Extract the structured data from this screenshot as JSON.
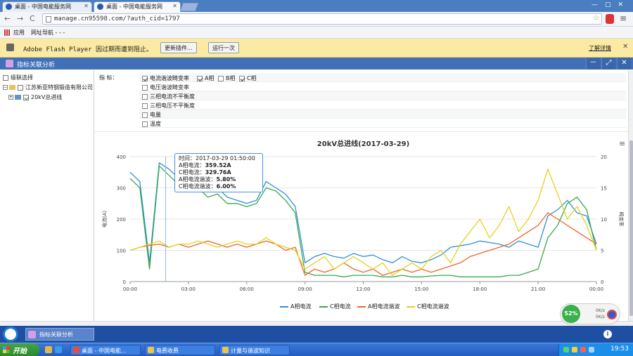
{
  "browser": {
    "tabs": [
      {
        "label": "桌面 - 中国电能服务网"
      },
      {
        "label": "桌面 - 中国电能服务网"
      }
    ],
    "url": "manage.cn95598.com/?auth_cid=1797",
    "bookmarks": {
      "apps": "应用",
      "nav": "网址导航 - - -"
    }
  },
  "flash_bar": {
    "message": "Adobe Flash Player 因过期而遭到阻止。",
    "update_btn": "更新插件...",
    "run_btn": "运行一次",
    "learn_more": "了解详情"
  },
  "app": {
    "title": "指标关联分析",
    "header_btns": {
      "min": "－",
      "max": "⤢",
      "close": "✕"
    }
  },
  "tree": {
    "header": "级联选择",
    "company": "江苏新亚特钢锻造有限公司",
    "line": "20kV总进线"
  },
  "filter": {
    "label": "指 标：",
    "rows": [
      [
        {
          "label": "电流谐波畸变率",
          "checked": true
        },
        {
          "label": "A相",
          "checked": true
        },
        {
          "label": "B相",
          "checked": false
        },
        {
          "label": "C相",
          "checked": true
        }
      ],
      [
        {
          "label": "电压谐波畸变率",
          "checked": false
        }
      ],
      [
        {
          "label": "三相电流不平衡度",
          "checked": false
        }
      ],
      [
        {
          "label": "三相电压不平衡度",
          "checked": false
        }
      ],
      [
        {
          "label": "电量",
          "checked": false
        }
      ],
      [
        {
          "label": "温度",
          "checked": false
        }
      ]
    ]
  },
  "tooltip": {
    "time_label": "时间：",
    "time": "2017-03-29 01:50:00",
    "a_cur_label": "A相电流：",
    "a_cur": "359.52A",
    "c_cur_label": "C相电流：",
    "c_cur": "329.76A",
    "a_h_label": "A相电流谐波：",
    "a_h": "5.80%",
    "c_h_label": "C相电流谐波：",
    "c_h": "6.00%"
  },
  "chart_data": {
    "type": "line",
    "title": "20kV总进线(2017-03-29)",
    "ylabel": "电流(A)",
    "y2label": "畸变率",
    "ylim": [
      0,
      400
    ],
    "y2lim": [
      0,
      20
    ],
    "yticks": [
      0,
      100,
      200,
      300,
      400
    ],
    "y2ticks": [
      0,
      5,
      10,
      15,
      20
    ],
    "xticks": [
      "00:00",
      "03:00",
      "06:00",
      "09:00",
      "12:00",
      "15:00",
      "18:00",
      "21:00",
      "00:00"
    ],
    "xlim_hours": [
      0,
      24
    ],
    "colors": {
      "a_cur": "#2f8fd8",
      "c_cur": "#3aa84a",
      "a_h": "#f0642a",
      "c_h": "#e6d21e"
    },
    "series": [
      {
        "name": "A相电流",
        "axis": "left",
        "x": [
          0,
          0.5,
          1,
          1.5,
          2,
          2.5,
          3,
          3.5,
          4,
          4.5,
          5,
          5.5,
          6,
          6.5,
          7,
          7.5,
          8,
          8.5,
          9,
          9.5,
          10,
          10.5,
          11,
          11.5,
          12,
          12.5,
          13,
          13.5,
          14,
          14.5,
          15,
          15.5,
          16,
          16.5,
          17,
          17.5,
          18,
          18.5,
          19,
          19.5,
          20,
          20.5,
          21,
          21.5,
          22,
          22.5,
          23,
          23.5,
          24
        ],
        "y": [
          350,
          320,
          60,
          380,
          360,
          330,
          340,
          320,
          290,
          300,
          270,
          260,
          250,
          260,
          320,
          300,
          280,
          240,
          60,
          80,
          90,
          80,
          75,
          90,
          80,
          85,
          70,
          60,
          80,
          65,
          60,
          70,
          85,
          110,
          115,
          120,
          130,
          125,
          120,
          110,
          130,
          120,
          110,
          210,
          230,
          260,
          220,
          210,
          120
        ]
      },
      {
        "name": "C相电流",
        "axis": "left",
        "x": [
          0,
          0.5,
          1,
          1.5,
          2,
          2.5,
          3,
          3.5,
          4,
          4.5,
          5,
          5.5,
          6,
          6.5,
          7,
          7.5,
          8,
          8.5,
          9,
          9.5,
          10,
          10.5,
          11,
          11.5,
          12,
          12.5,
          13,
          13.5,
          14,
          14.5,
          15,
          15.5,
          16,
          16.5,
          17,
          17.5,
          18,
          18.5,
          19,
          19.5,
          20,
          20.5,
          21,
          21.5,
          22,
          22.5,
          23,
          23.5,
          24
        ],
        "y": [
          330,
          300,
          40,
          370,
          340,
          310,
          320,
          300,
          270,
          280,
          250,
          250,
          240,
          250,
          300,
          290,
          260,
          220,
          30,
          20,
          20,
          20,
          15,
          20,
          20,
          20,
          15,
          15,
          20,
          15,
          15,
          18,
          20,
          20,
          15,
          15,
          15,
          15,
          15,
          20,
          20,
          30,
          40,
          140,
          180,
          250,
          270,
          230,
          100
        ]
      },
      {
        "name": "A相电流谐波",
        "axis": "right",
        "x": [
          0,
          0.5,
          1,
          1.5,
          2,
          2.5,
          3,
          3.5,
          4,
          4.5,
          5,
          5.5,
          6,
          6.5,
          7,
          7.5,
          8,
          8.5,
          9,
          9.5,
          10,
          10.5,
          11,
          11.5,
          12,
          12.5,
          13,
          13.5,
          14,
          14.5,
          15,
          15.5,
          16,
          16.5,
          17,
          17.5,
          18,
          18.5,
          19,
          19.5,
          20,
          20.5,
          21,
          21.5,
          22,
          22.5,
          23,
          23.5,
          24
        ],
        "y": [
          5,
          5.5,
          5.8,
          6,
          5.5,
          6,
          5.5,
          6,
          6.5,
          6,
          5.5,
          6,
          5.5,
          6,
          6.5,
          6,
          5,
          5.5,
          1,
          2,
          1.5,
          2,
          3,
          2,
          1.5,
          2,
          1,
          1.5,
          2,
          1.5,
          2,
          1.5,
          2,
          2.5,
          3,
          4,
          4.5,
          5,
          5.5,
          6,
          7,
          8,
          9,
          11,
          10,
          9,
          8,
          7,
          6
        ]
      },
      {
        "name": "C相电流谐波",
        "axis": "right",
        "x": [
          0,
          0.5,
          1,
          1.5,
          2,
          2.5,
          3,
          3.5,
          4,
          4.5,
          5,
          5.5,
          6,
          6.5,
          7,
          7.5,
          8,
          8.5,
          9,
          9.5,
          10,
          10.5,
          11,
          11.5,
          12,
          12.5,
          13,
          13.5,
          14,
          14.5,
          15,
          15.5,
          16,
          16.5,
          17,
          17.5,
          18,
          18.5,
          19,
          19.5,
          20,
          20.5,
          21,
          21.5,
          22,
          22.5,
          23,
          23.5,
          24
        ],
        "y": [
          5,
          5.5,
          6,
          6.5,
          5.5,
          6,
          6,
          6.5,
          6,
          5.5,
          6,
          6.5,
          6,
          6,
          7,
          6,
          5.5,
          5,
          2,
          3,
          4,
          2,
          3,
          4,
          3,
          2,
          3,
          1,
          2,
          3,
          2,
          4,
          5,
          3,
          6,
          8,
          10,
          7,
          9,
          12,
          8,
          10,
          13,
          18,
          14,
          10,
          12,
          9,
          5
        ]
      }
    ]
  },
  "widget": {
    "pct": "52%",
    "up": "0K/s",
    "down": "0K/s"
  },
  "dock": {
    "task": "指标关联分析",
    "info": "i"
  },
  "taskbar": {
    "start": "开始",
    "buttons": [
      "桌面 - 中国电能...",
      "电费收费",
      "计量与谐波知识"
    ],
    "clock": "19:53"
  }
}
